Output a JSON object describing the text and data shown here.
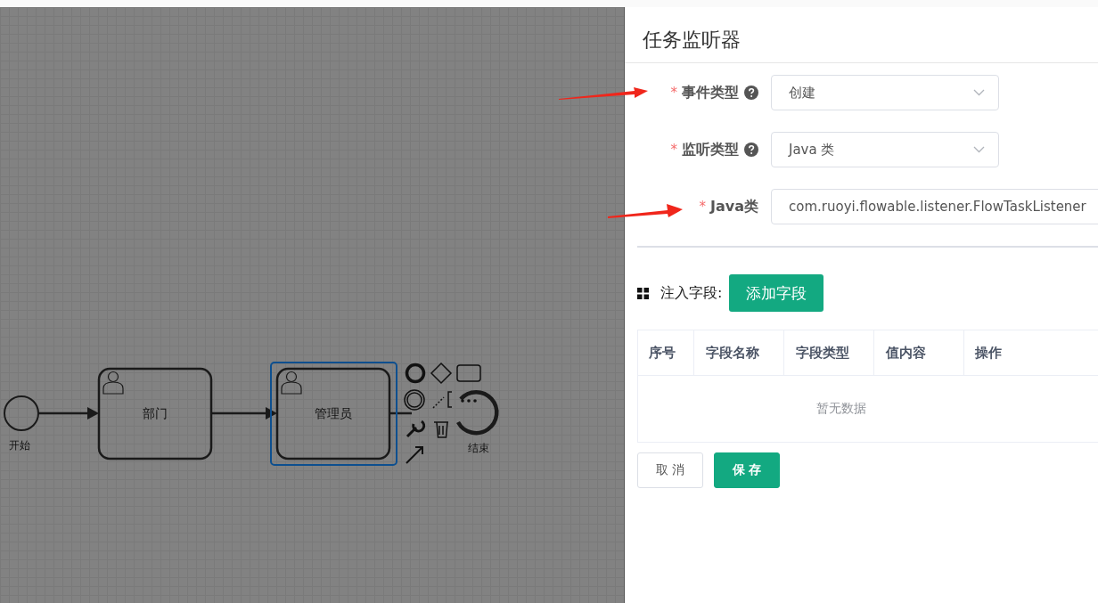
{
  "diagram": {
    "nodes": [
      {
        "kind": "start",
        "label": "开始"
      },
      {
        "kind": "task",
        "label": "部门",
        "selected": false
      },
      {
        "kind": "task",
        "label": "管理员",
        "selected": true
      },
      {
        "kind": "end",
        "label": "结束"
      }
    ]
  },
  "drawer": {
    "title": "任务监听器",
    "fields": [
      {
        "kind": "select",
        "label": "事件类型",
        "required_mark": "*",
        "help": true,
        "value": "创建"
      },
      {
        "kind": "select",
        "label": "监听类型",
        "required_mark": "*",
        "help": true,
        "value": "Java 类"
      },
      {
        "kind": "input",
        "label": "Java类",
        "required_mark": "*",
        "value": "com.ruoyi.flowable.listener.FlowTaskListener"
      }
    ],
    "inject": {
      "label": "注入字段:",
      "button": "添加字段"
    },
    "table": {
      "columns": [
        "序号",
        "字段名称",
        "字段类型",
        "值内容",
        "操作"
      ],
      "empty": "暂无数据"
    },
    "buttons": [
      {
        "kind": "default",
        "label": "取 消"
      },
      {
        "kind": "primary",
        "label": "保 存"
      }
    ]
  }
}
